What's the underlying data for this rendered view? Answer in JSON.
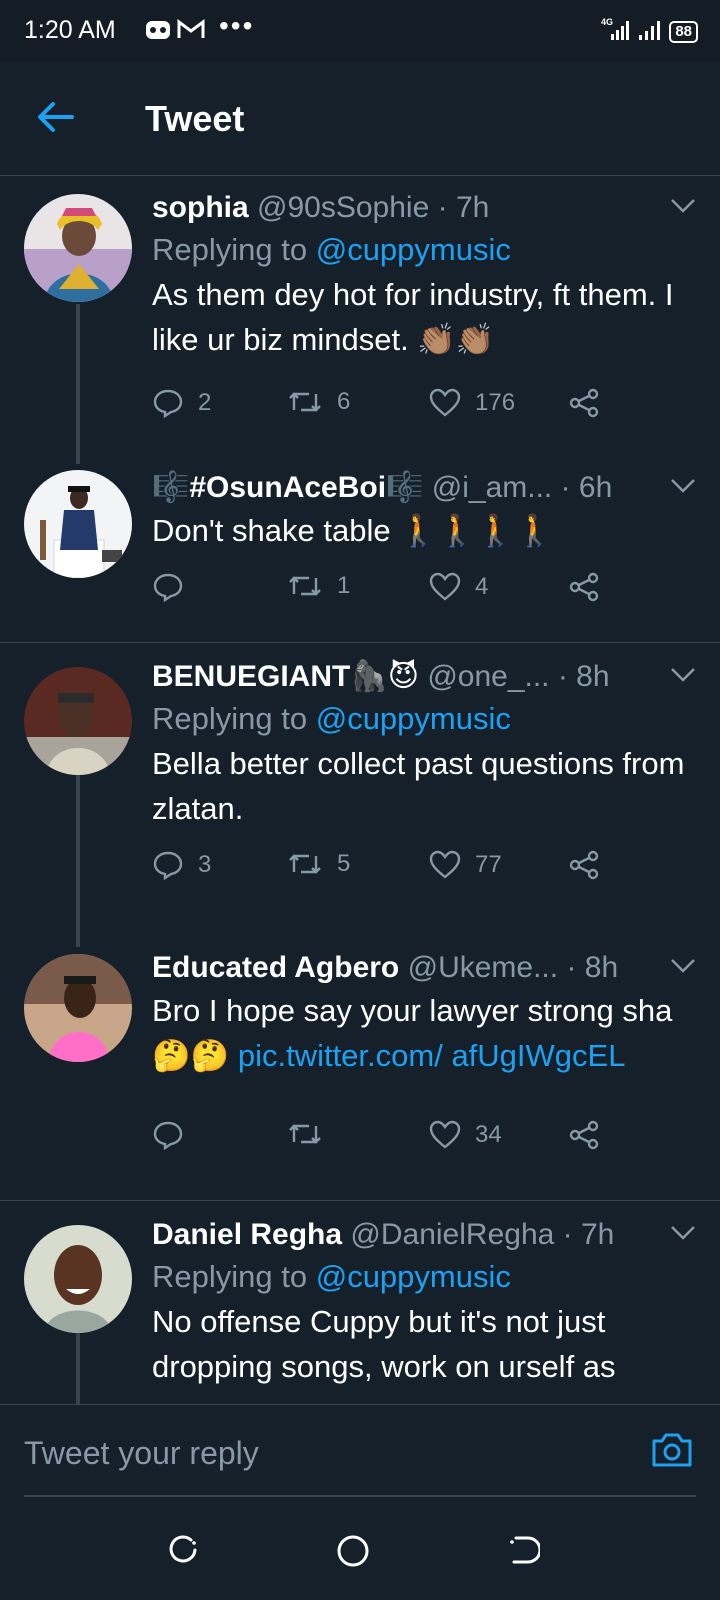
{
  "status_bar": {
    "time": "1:20 AM",
    "dots": "•••",
    "network": "4G",
    "battery": "88",
    "icons": [
      "gamepad-icon",
      "gmail-icon",
      "signal-icon",
      "wifi-icon",
      "battery-icon"
    ]
  },
  "header": {
    "title": "Tweet",
    "back_icon": "arrow-left-icon"
  },
  "tweets": [
    {
      "name": "sophia",
      "handle": "@90sSophie",
      "time": "· 7h",
      "replying_prefix": "Replying to",
      "replying_handle": "@cuppymusic",
      "text": "As them dey hot for industry, ft them. I like ur biz mindset. 👏🏽👏🏽",
      "replies": "2",
      "retweets": "6",
      "likes": "176"
    },
    {
      "name": "🎼#OsunAceBoi🎼",
      "handle": "@i_am...",
      "time": "· 6h",
      "text": "Don't shake table 🚶🚶🚶🚶",
      "replies": "",
      "retweets": "1",
      "likes": "4"
    },
    {
      "name": "BENUEGIANT🦍😈",
      "handle": "@one_...",
      "time": "· 8h",
      "replying_prefix": "Replying to",
      "replying_handle": "@cuppymusic",
      "text": "Bella better collect past questions from zlatan.",
      "replies": "3",
      "retweets": "5",
      "likes": "77"
    },
    {
      "name": "Educated Agbero",
      "handle": "@Ukeme...",
      "time": "· 8h",
      "text_main": "Bro I hope say your lawyer strong sha 🤔🤔",
      "text_link": "pic.twitter.com/ afUgIWgcEL",
      "replies": "",
      "retweets": "",
      "likes": "34"
    },
    {
      "name": "Daniel Regha",
      "handle": "@DanielRegha",
      "time": "· 7h",
      "replying_prefix": "Replying to",
      "replying_handle": "@cuppymusic",
      "text": "No offense Cuppy but it's not just dropping songs, work on urself as"
    }
  ],
  "reply_bar": {
    "placeholder": "Tweet your reply",
    "camera_icon": "camera-icon"
  },
  "colors": {
    "background": "#15202b",
    "accent": "#1da1f2",
    "secondary_text": "#8899a6",
    "divider": "#38444d"
  }
}
